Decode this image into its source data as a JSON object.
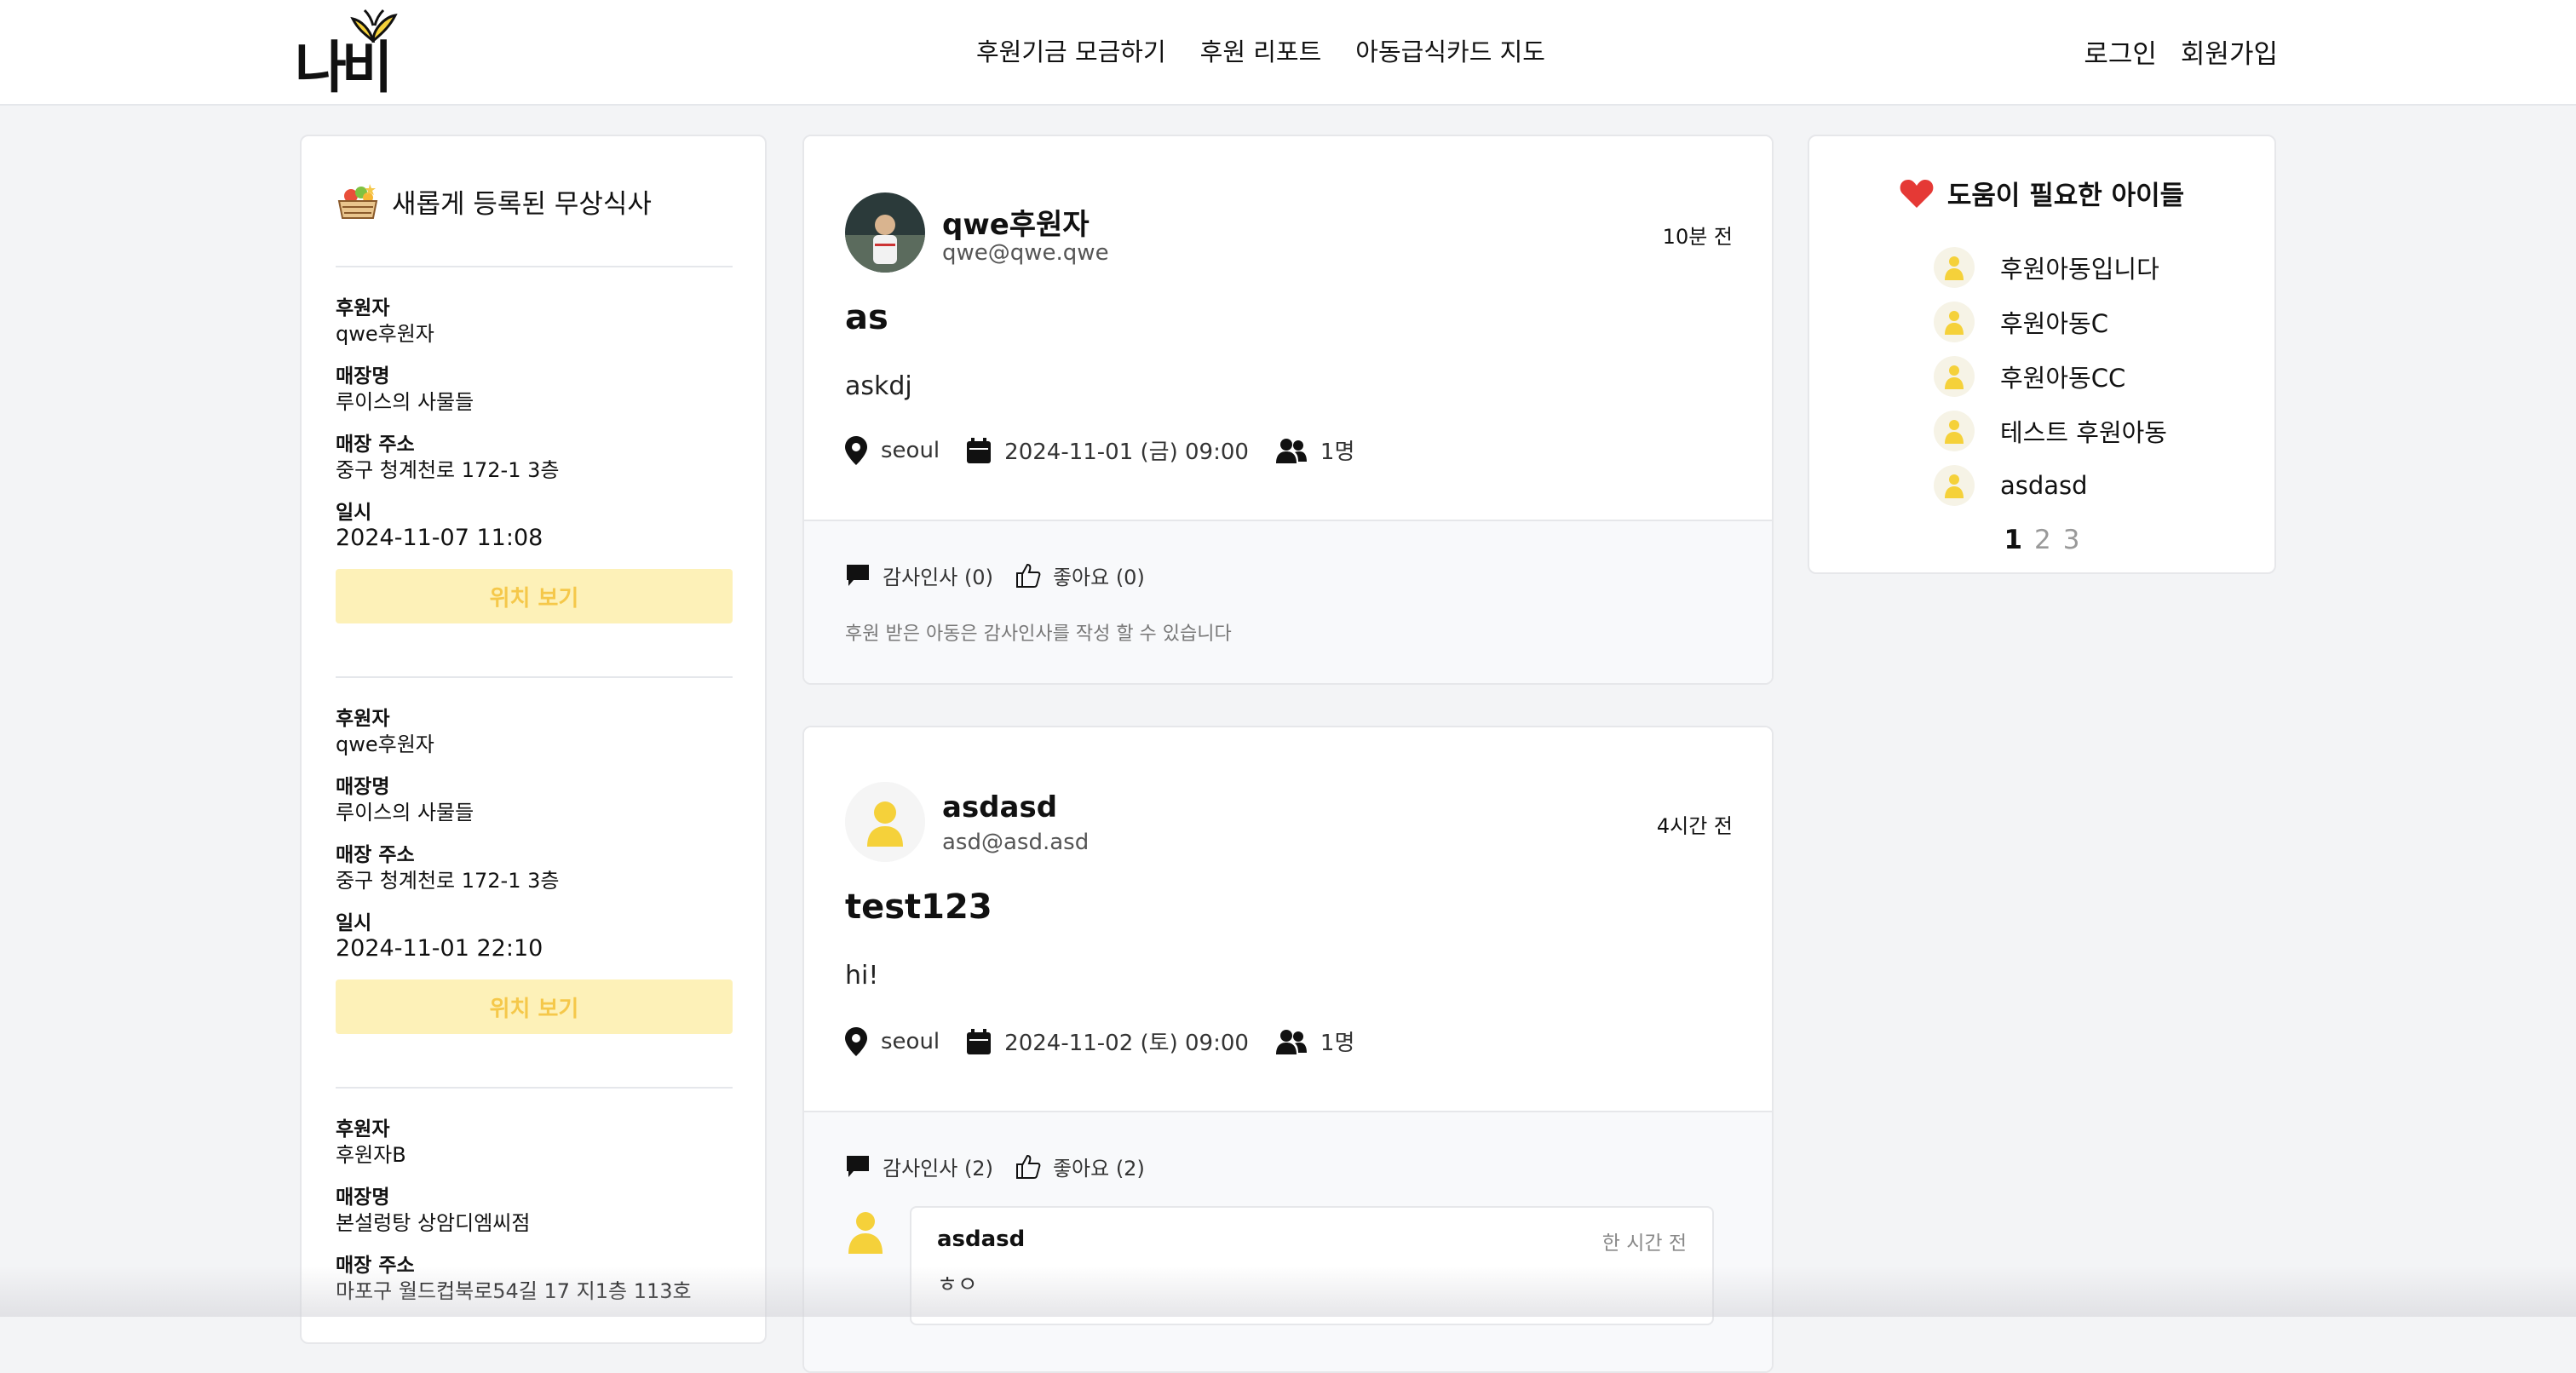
{
  "logo": "나비",
  "nav": [
    "후원기금 모금하기",
    "후원 리포트",
    "아동급식카드 지도"
  ],
  "auth": {
    "login": "로그인",
    "signup": "회원가입"
  },
  "left": {
    "title": "새롭게 등록된 무상식사",
    "items": [
      {
        "sponsor_label": "후원자",
        "sponsor": "qwe후원자",
        "store_label": "매장명",
        "store": "루이스의 사물들",
        "addr_label": "매장 주소",
        "addr": "중구 청계천로 172-1 3층",
        "date_label": "일시",
        "date": "2024-11-07 11:08",
        "button": "위치 보기"
      },
      {
        "sponsor_label": "후원자",
        "sponsor": "qwe후원자",
        "store_label": "매장명",
        "store": "루이스의 사물들",
        "addr_label": "매장 주소",
        "addr": "중구 청계천로 172-1 3층",
        "date_label": "일시",
        "date": "2024-11-01 22:10",
        "button": "위치 보기"
      },
      {
        "sponsor_label": "후원자",
        "sponsor": "후원자B",
        "store_label": "매장명",
        "store": "본설렁탕 상암디엠씨점",
        "addr_label": "매장 주소",
        "addr": "마포구 월드컵북로54길 17 지1층 113호"
      }
    ]
  },
  "posts": [
    {
      "author": "qwe후원자",
      "email": "qwe@qwe.qwe",
      "time": "10분 전",
      "title": "as",
      "body": "askdj",
      "location": "seoul",
      "date": "2024-11-01 (금) 09:00",
      "people": "1명",
      "thanks": "감사인사 (0)",
      "likes": "좋아요 (0)",
      "note": "후원 받은 아동은 감사인사를 작성 할 수 있습니다"
    },
    {
      "author": "asdasd",
      "email": "asd@asd.asd",
      "time": "4시간 전",
      "title": "test123",
      "body": "hi!",
      "location": "seoul",
      "date": "2024-11-02 (토) 09:00",
      "people": "1명",
      "thanks": "감사인사 (2)",
      "likes": "좋아요 (2)",
      "comment": {
        "name": "asdasd",
        "time": "한 시간 전",
        "text": "ㅎㅇ"
      }
    }
  ],
  "right": {
    "title": "도움이 필요한 아이들",
    "children": [
      "후원아동입니다",
      "후원아동C",
      "후원아동CC",
      "테스트 후원아동",
      "asdasd"
    ],
    "pages": [
      "1",
      "2",
      "3"
    ]
  },
  "colors": {
    "accent": "#f5c84a",
    "accent_light": "#fdf1b8",
    "heart": "#e53935"
  }
}
